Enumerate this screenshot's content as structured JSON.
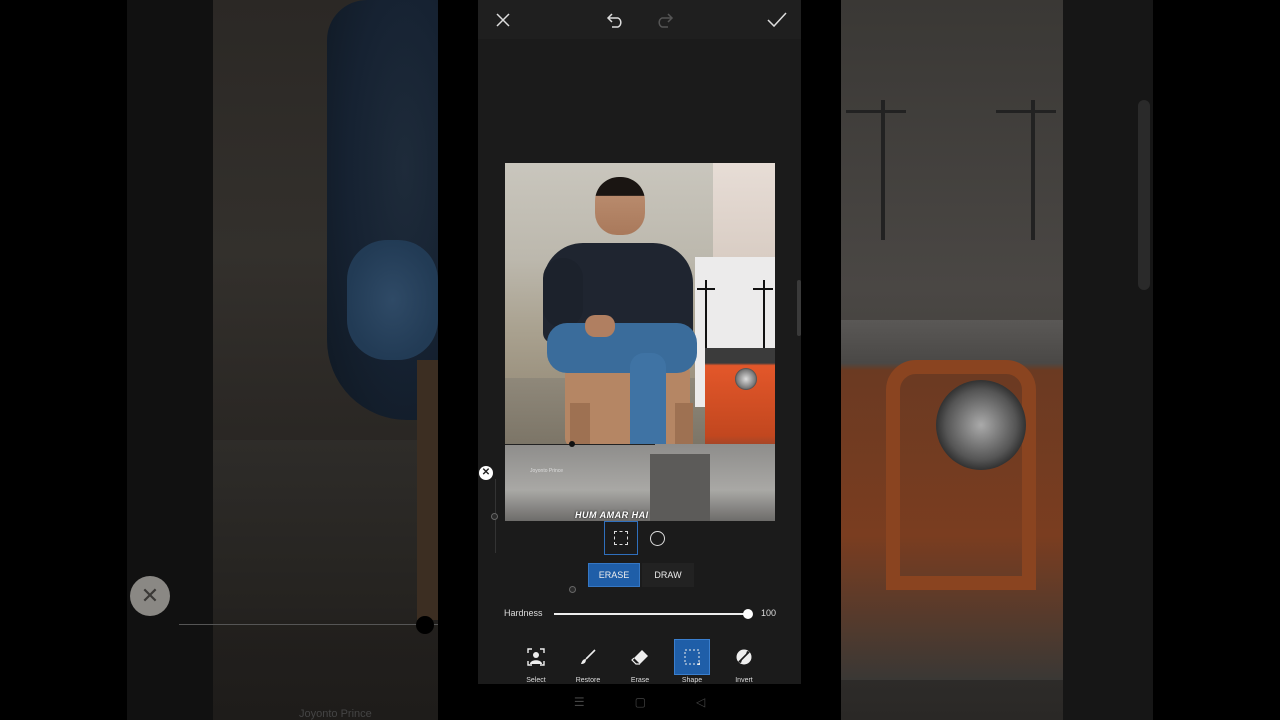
{
  "topbar": {
    "close_icon": "close-icon",
    "undo_icon": "undo-icon",
    "redo_icon": "redo-icon",
    "apply_icon": "check-icon"
  },
  "canvas": {
    "caption": "HUM AMAR HAI",
    "watermark": "Joyonto Prince"
  },
  "shape_options": [
    {
      "icon": "rectangle-shape-icon",
      "selected": true
    },
    {
      "icon": "circle-shape-icon",
      "selected": false
    }
  ],
  "mode": {
    "erase_label": "ERASE",
    "draw_label": "DRAW",
    "selected": "ERASE"
  },
  "hardness": {
    "label": "Hardness",
    "value": "100",
    "level": 1.0
  },
  "tools": [
    {
      "label": "Select",
      "icon": "select-person-icon",
      "active": false
    },
    {
      "label": "Restore",
      "icon": "brush-icon",
      "active": false
    },
    {
      "label": "Erase",
      "icon": "eraser-icon",
      "active": false
    },
    {
      "label": "Shape",
      "icon": "shape-icon",
      "active": true
    },
    {
      "label": "Invert",
      "icon": "invert-icon",
      "active": false
    }
  ],
  "background": {
    "caption": "Joyonto Prince"
  },
  "colors": {
    "accent": "#1f5ea8",
    "panel": "#1b1b1b"
  }
}
